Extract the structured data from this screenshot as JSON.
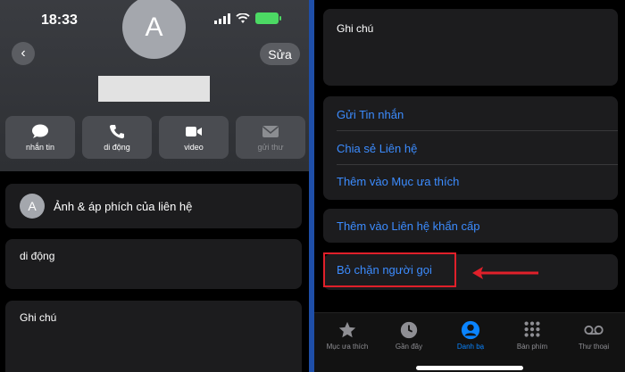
{
  "left": {
    "status": {
      "time": "18:33"
    },
    "avatar_initial": "A",
    "edit_label": "Sửa",
    "actions": [
      {
        "label": "nhắn tin",
        "icon": "message-icon"
      },
      {
        "label": "di động",
        "icon": "phone-icon"
      },
      {
        "label": "video",
        "icon": "video-icon"
      },
      {
        "label": "gửi thư",
        "icon": "mail-icon"
      }
    ],
    "photo_card": {
      "avatar_initial": "A",
      "label": "Ảnh & áp phích của liên hệ"
    },
    "mobile_label": "di động",
    "note_label": "Ghi chú"
  },
  "right": {
    "note_label": "Ghi chú",
    "group_items": [
      "Gửi Tin nhắn",
      "Chia sẻ Liên hệ",
      "Thêm vào Mục ưa thích"
    ],
    "emergency_label": "Thêm vào Liên hệ khẩn cấp",
    "block_label": "Bỏ chặn người gọi",
    "tabs": [
      {
        "label": "Mục ưa thích",
        "icon": "star-icon",
        "active": false
      },
      {
        "label": "Gần đây",
        "icon": "clock-icon",
        "active": false
      },
      {
        "label": "Danh bạ",
        "icon": "person-icon",
        "active": true
      },
      {
        "label": "Bàn phím",
        "icon": "keypad-icon",
        "active": false
      },
      {
        "label": "Thư thoại",
        "icon": "voicemail-icon",
        "active": false
      }
    ]
  },
  "colors": {
    "link": "#3c8cff",
    "highlight": "#e0202a",
    "active_tab": "#0a84ff",
    "divider": "#1e4ea8"
  }
}
